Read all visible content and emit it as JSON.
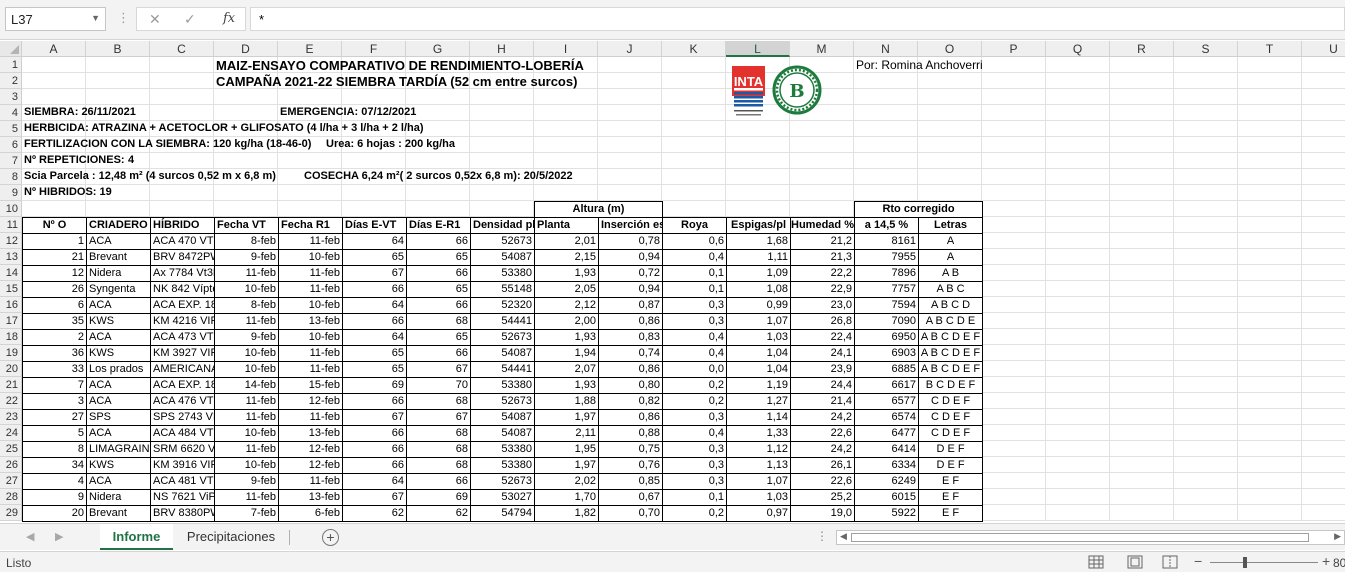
{
  "formula_bar": {
    "name_box": "L37",
    "cancel_icon": "✕",
    "confirm_icon": "✓",
    "fx_label": "fx",
    "formula": "*"
  },
  "columns": [
    "A",
    "B",
    "C",
    "D",
    "E",
    "F",
    "G",
    "H",
    "I",
    "J",
    "K",
    "L",
    "M",
    "N",
    "O",
    "P",
    "Q",
    "R",
    "S",
    "T",
    "U"
  ],
  "selected_column": "L",
  "rows": [
    "1",
    "2",
    "3",
    "4",
    "5",
    "6",
    "7",
    "8",
    "9",
    "10",
    "11",
    "12",
    "13",
    "14",
    "15",
    "16",
    "17",
    "18",
    "19",
    "20",
    "21",
    "22",
    "23",
    "24",
    "25",
    "26",
    "27",
    "28",
    "29"
  ],
  "sheet": {
    "title1": "MAIZ-ENSAYO COMPARATIVO DE RENDIMIENTO-LOBERÍA",
    "title2": "CAMPAÑA 2021-22 SIEMBRA TARDÍA (52 cm entre surcos)",
    "author": "Por: Romina Anchoverri",
    "siembra": "SIEMBRA: 26/11/2021",
    "emergencia": "EMERGENCIA: 07/12/2021",
    "herbicida": "HERBICIDA: ATRAZINA + ACETOCLOR + GLIFOSATO (4 l/ha + 3 l/ha + 2 l/ha)",
    "fertilizacion": "FERTILIZACION CON LA SIEMBRA: 120 kg/ha (18-46-0)",
    "urea": "Urea: 6 hojas : 200 kg/ha",
    "repeticiones_label": "Nº REPETICIONES:",
    "repeticiones_value": "4",
    "parcela": "Scia Parcela : 12,48 m² (4 surcos 0,52 m x 6,8 m)",
    "cosecha": "COSECHA 6,24 m²( 2 surcos 0,52x 6,8 m): 20/5/2022",
    "hibridos": "Nº HIBRIDOS: 19",
    "group_altura": "Altura (m)",
    "group_rto": "Rto corregido",
    "headers": [
      "Nº O",
      "CRIADERO",
      "HÍBRIDO",
      "Fecha VT",
      "Fecha R1",
      "Días E-VT",
      "Días E-R1",
      "Densidad pl/ha",
      "Planta",
      "Inserción espiga",
      "Roya",
      "Espigas/pl",
      "Humedad %",
      "a 14,5 %",
      "Letras"
    ],
    "data": [
      [
        "1",
        "ACA",
        "ACA 470 VT3P",
        "8-feb",
        "11-feb",
        "64",
        "66",
        "52673",
        "2,01",
        "0,78",
        "0,6",
        "1,68",
        "21,2",
        "8161",
        "A"
      ],
      [
        "21",
        "Brevant",
        "BRV 8472PWU",
        "9-feb",
        "10-feb",
        "65",
        "65",
        "54087",
        "2,15",
        "0,94",
        "0,4",
        "1,11",
        "21,3",
        "7955",
        "A"
      ],
      [
        "12",
        "Nidera",
        "Ax 7784 Vt3P",
        "11-feb",
        "11-feb",
        "67",
        "66",
        "53380",
        "1,93",
        "0,72",
        "0,1",
        "1,09",
        "22,2",
        "7896",
        "A B"
      ],
      [
        "26",
        "Syngenta",
        "NK 842 Víptera3",
        "10-feb",
        "11-feb",
        "66",
        "65",
        "55148",
        "2,05",
        "0,94",
        "0,1",
        "1,08",
        "22,9",
        "7757",
        "A B C"
      ],
      [
        "6",
        "ACA",
        "ACA EXP. 18BT",
        "8-feb",
        "10-feb",
        "64",
        "66",
        "52320",
        "2,12",
        "0,87",
        "0,3",
        "0,99",
        "23,0",
        "7594",
        "A B C D"
      ],
      [
        "35",
        "KWS",
        "KM 4216 VIP3",
        "11-feb",
        "13-feb",
        "66",
        "68",
        "54441",
        "2,00",
        "0,86",
        "0,3",
        "1,07",
        "26,8",
        "7090",
        "A B C D E"
      ],
      [
        "2",
        "ACA",
        "ACA 473 VT3P",
        "9-feb",
        "10-feb",
        "64",
        "65",
        "52673",
        "1,93",
        "0,83",
        "0,4",
        "1,03",
        "22,4",
        "6950",
        "A B C D E F"
      ],
      [
        "36",
        "KWS",
        "KM 3927 VIP3",
        "10-feb",
        "11-feb",
        "65",
        "66",
        "54087",
        "1,94",
        "0,74",
        "0,4",
        "1,04",
        "24,1",
        "6903",
        "A B C D E F"
      ],
      [
        "33",
        "Los prados",
        "AMERICANA",
        "10-feb",
        "11-feb",
        "65",
        "67",
        "54441",
        "2,07",
        "0,86",
        "0,0",
        "1,04",
        "23,9",
        "6885",
        "A B C D E F"
      ],
      [
        "7",
        "ACA",
        "ACA EXP. 18BT",
        "14-feb",
        "15-feb",
        "69",
        "70",
        "53380",
        "1,93",
        "0,80",
        "0,2",
        "1,19",
        "24,4",
        "6617",
        "B C D E F"
      ],
      [
        "3",
        "ACA",
        "ACA 476 VT3P",
        "11-feb",
        "12-feb",
        "66",
        "68",
        "52673",
        "1,88",
        "0,82",
        "0,2",
        "1,27",
        "21,4",
        "6577",
        "C D E F"
      ],
      [
        "27",
        "SPS",
        "SPS 2743 VIP3",
        "11-feb",
        "11-feb",
        "67",
        "67",
        "54087",
        "1,97",
        "0,86",
        "0,3",
        "1,14",
        "24,2",
        "6574",
        "C D E F"
      ],
      [
        "5",
        "ACA",
        "ACA 484 VT3P",
        "10-feb",
        "13-feb",
        "66",
        "68",
        "54087",
        "2,11",
        "0,88",
        "0,4",
        "1,33",
        "22,6",
        "6477",
        "C D E F"
      ],
      [
        "8",
        "LIMAGRAIN",
        "SRM 6620 VT3P",
        "11-feb",
        "12-feb",
        "66",
        "68",
        "53380",
        "1,95",
        "0,75",
        "0,3",
        "1,12",
        "24,2",
        "6414",
        "D E F"
      ],
      [
        "34",
        "KWS",
        "KM 3916 VIP3",
        "10-feb",
        "12-feb",
        "66",
        "68",
        "53380",
        "1,97",
        "0,76",
        "0,3",
        "1,13",
        "26,1",
        "6334",
        "D E F"
      ],
      [
        "4",
        "ACA",
        "ACA 481 VT3P",
        "9-feb",
        "11-feb",
        "64",
        "66",
        "52673",
        "2,02",
        "0,85",
        "0,3",
        "1,07",
        "22,6",
        "6249",
        "E F"
      ],
      [
        "9",
        "Nidera",
        "NS 7621 ViP3",
        "11-feb",
        "13-feb",
        "67",
        "69",
        "53027",
        "1,70",
        "0,67",
        "0,1",
        "1,03",
        "25,2",
        "6015",
        "E F"
      ],
      [
        "20",
        "Brevant",
        "BRV 8380PWU",
        "7-feb",
        "6-feb",
        "62",
        "62",
        "54794",
        "1,82",
        "0,70",
        "0,2",
        "0,97",
        "19,0",
        "5922",
        "E F"
      ]
    ]
  },
  "tabs": {
    "prev_icon": "◀",
    "next_icon": "▶",
    "sheets": [
      "Informe",
      "Precipitaciones"
    ],
    "active": "Informe",
    "add_icon": "+",
    "dots": "⋮"
  },
  "status": {
    "text": "Listo",
    "zoom": "80"
  }
}
